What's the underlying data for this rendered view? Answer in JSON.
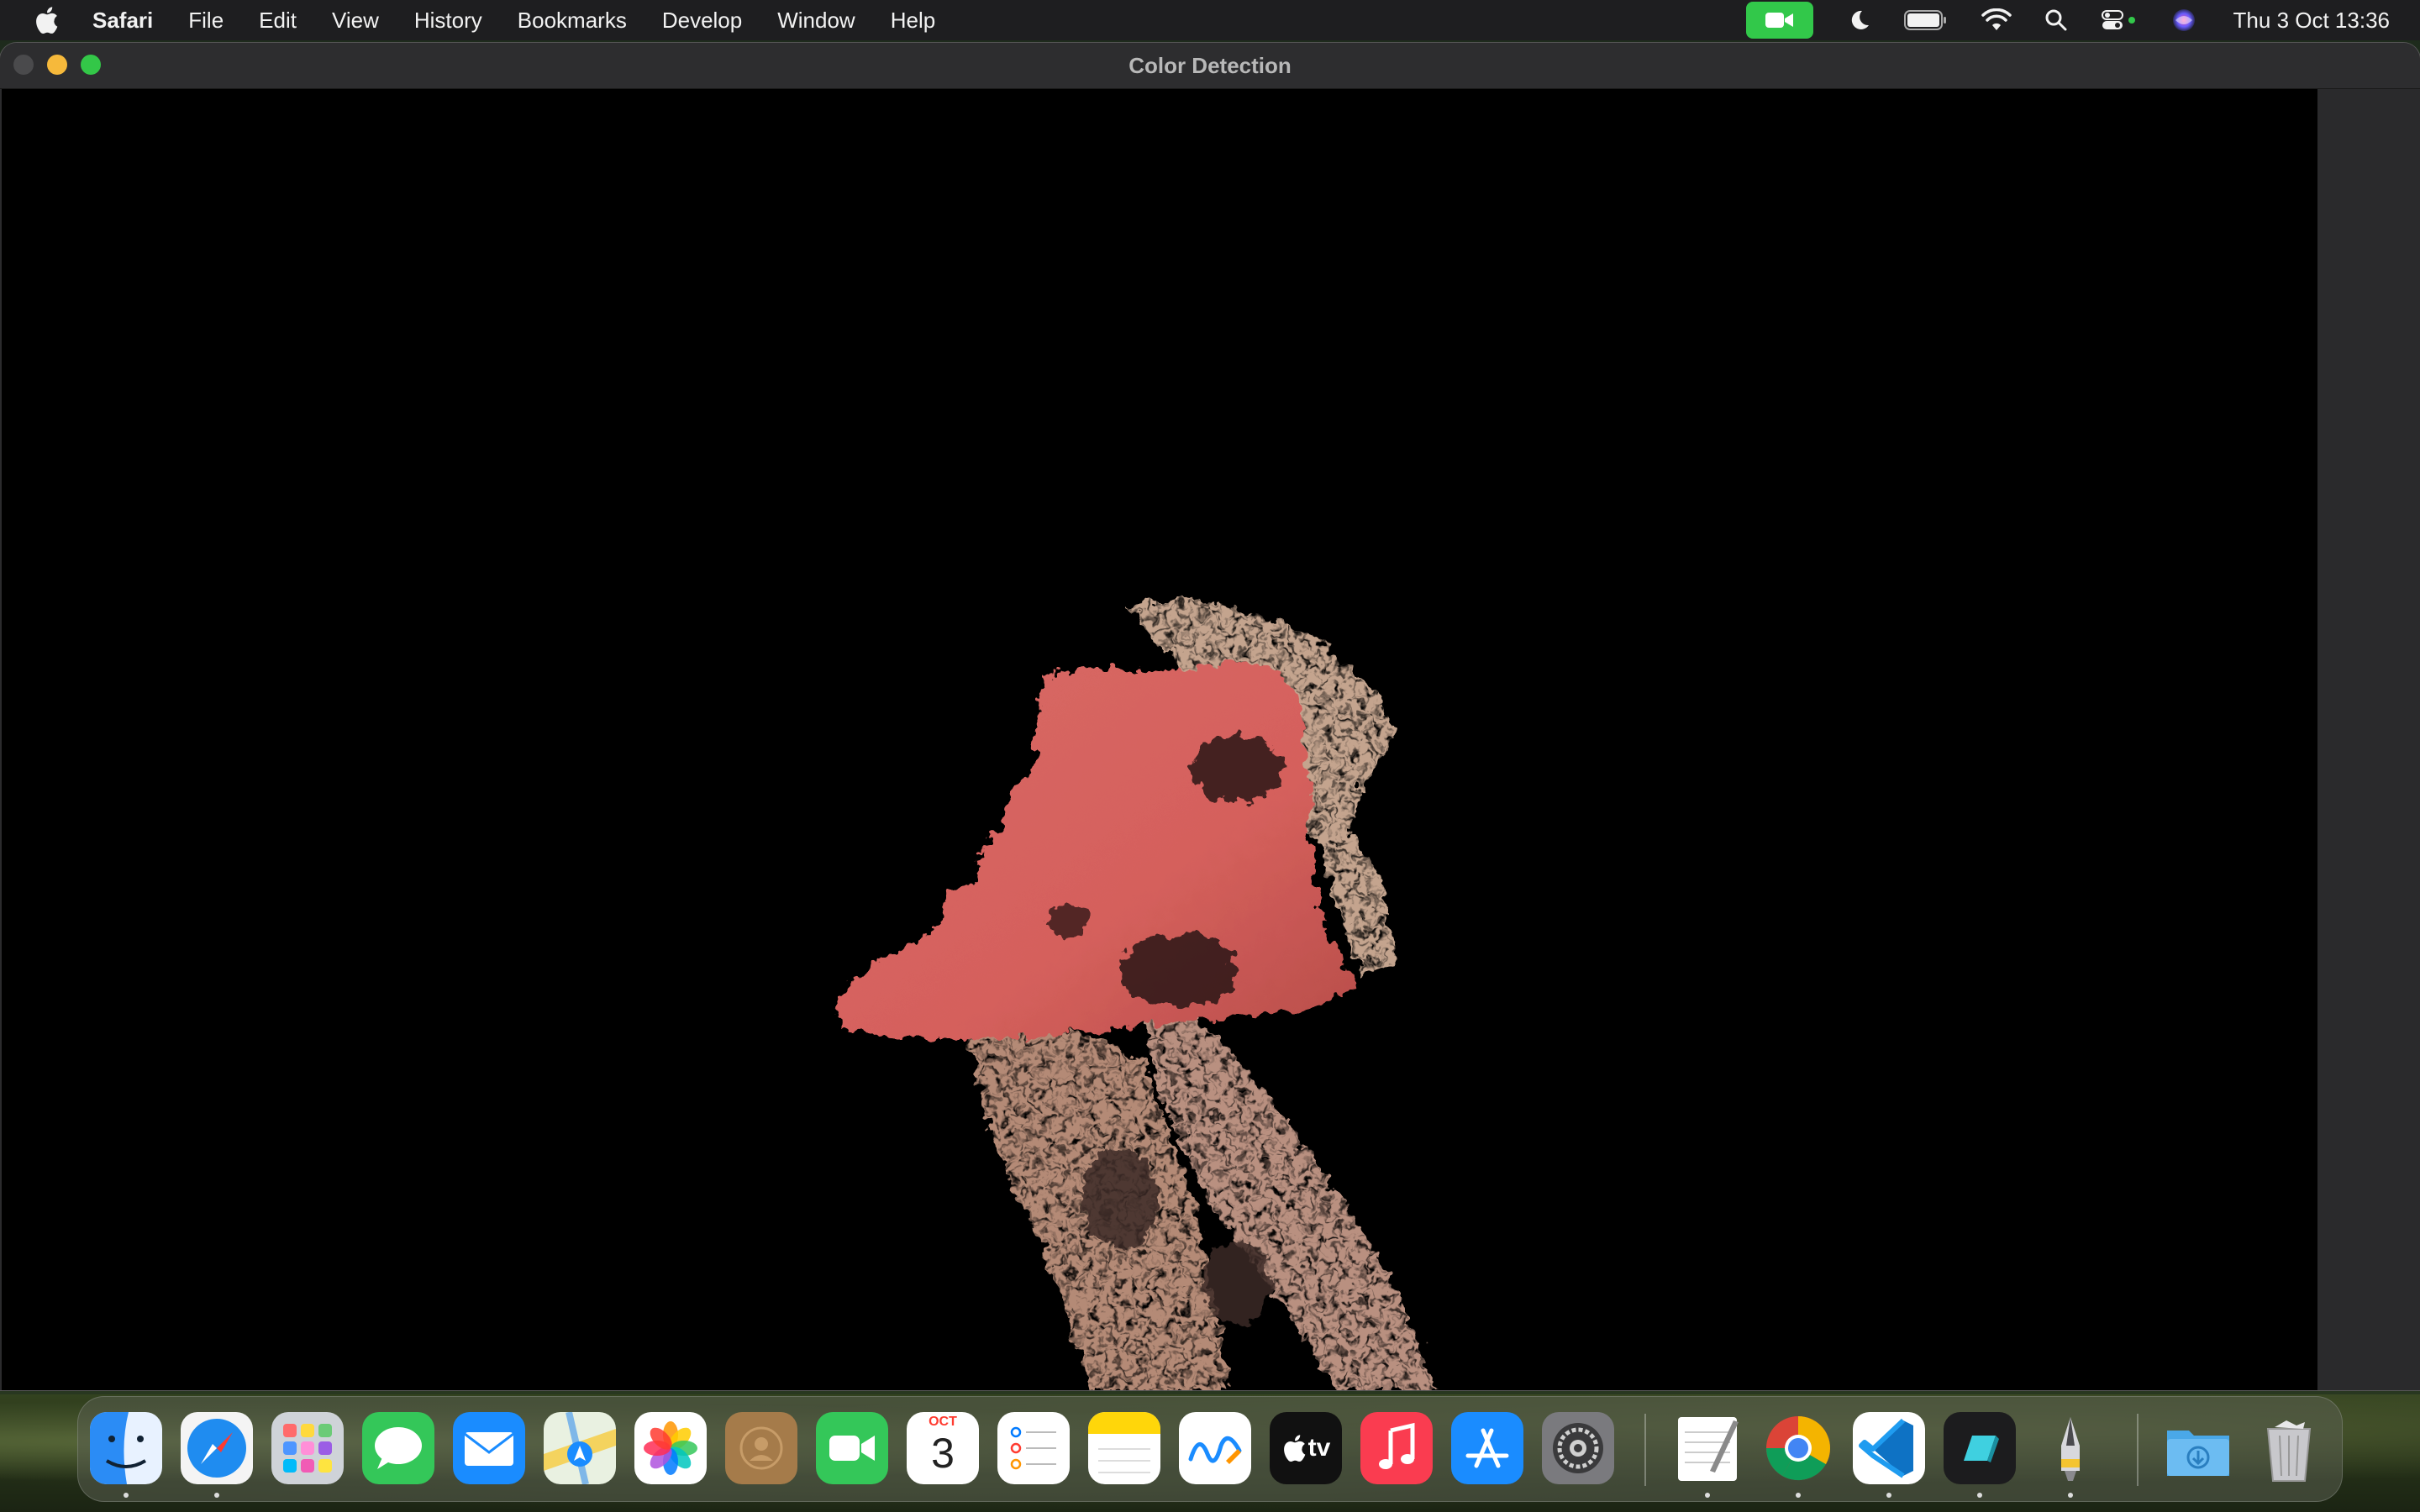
{
  "menubar": {
    "app_name": "Safari",
    "items": [
      "File",
      "Edit",
      "View",
      "History",
      "Bookmarks",
      "Develop",
      "Window",
      "Help"
    ],
    "clock": "Thu 3 Oct  13:36"
  },
  "window": {
    "title": "Color Detection"
  },
  "dock": {
    "calendar_month": "OCT",
    "calendar_day": "3",
    "tv_label": "tv",
    "apps": [
      "finder-icon",
      "safari-icon",
      "launchpad-icon",
      "messages-icon",
      "mail-icon",
      "maps-icon",
      "photos-icon",
      "contacts-icon",
      "facetime-icon",
      "calendar-icon",
      "reminders-icon",
      "notes-icon",
      "freeform-icon",
      "apple-tv-icon",
      "music-icon",
      "app-store-icon",
      "system-settings-icon",
      "textedit-icon",
      "chrome-icon",
      "vscode-icon",
      "unknown-app-icon",
      "pen-app-icon",
      "downloads-folder-icon",
      "trash-icon"
    ]
  },
  "colors": {
    "camera_indicator": "#32c84a",
    "mask_red": "#d5605c",
    "mask_skin": "#b48a76"
  }
}
